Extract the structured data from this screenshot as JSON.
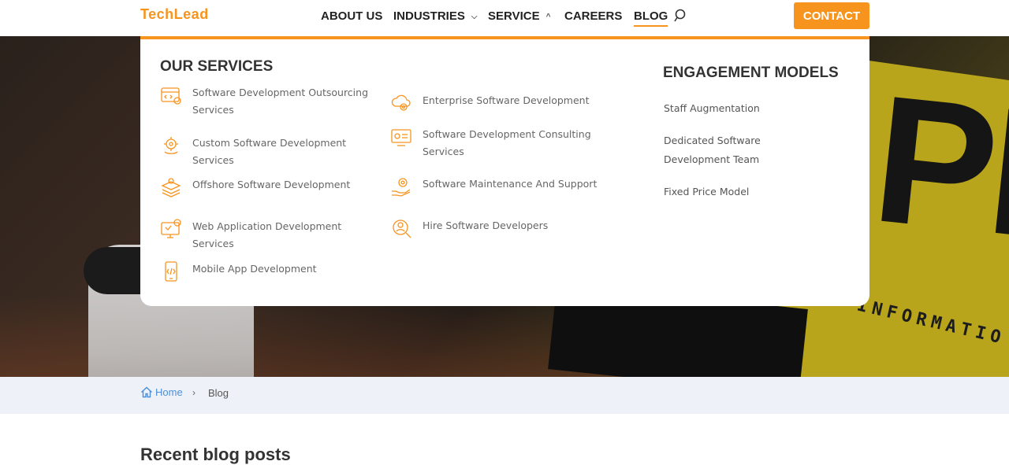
{
  "brand": {
    "logo_text": "TechLead",
    "accent": "#f7941d"
  },
  "nav": {
    "items": [
      {
        "label": "ABOUT US"
      },
      {
        "label": "INDUSTRIES"
      },
      {
        "label": "SERVICE"
      },
      {
        "label": "CAREERS"
      },
      {
        "label": "BLOG"
      }
    ],
    "contact_label": "CONTACT"
  },
  "dropdown": {
    "services_heading": "OUR SERVICES",
    "services": [
      {
        "label": "Software Development Outsourcing Services",
        "icon": "code-window-icon"
      },
      {
        "label": "Enterprise Software Development",
        "icon": "cloud-gear-icon"
      },
      {
        "label": "Custom Software Development Services",
        "icon": "custom-gear-icon"
      },
      {
        "label": "Software Development Consulting Services",
        "icon": "monitor-gear-icon"
      },
      {
        "label": "Offshore Software Development",
        "icon": "layers-gear-icon"
      },
      {
        "label": "Software Maintenance And Support",
        "icon": "hand-gear-icon"
      },
      {
        "label": "Web Application Development Services",
        "icon": "web-monitor-icon"
      },
      {
        "label": "Hire Software Developers",
        "icon": "person-search-icon"
      },
      {
        "label": "Mobile App Development",
        "icon": "mobile-code-icon"
      }
    ],
    "engagement_heading": "ENGAGEMENT MODELS",
    "engagement": [
      {
        "label": "Staff Augmentation"
      },
      {
        "label": "Dedicated Software Development Team"
      },
      {
        "label": "Fixed Price Model"
      }
    ]
  },
  "hero": {
    "sign_text": "MORE INFORMATIO",
    "big_letters": "PLO"
  },
  "breadcrumb": {
    "home": "Home",
    "separator": "›",
    "current": "Blog"
  },
  "main": {
    "section_title": "Recent blog posts"
  }
}
